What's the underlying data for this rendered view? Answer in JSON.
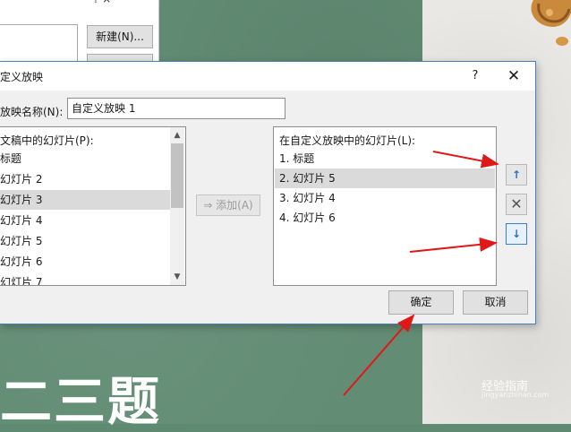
{
  "background_dialog": {
    "new_button": "新建(N)...",
    "title_icons": "?   ×"
  },
  "dialog": {
    "title": "定义放映",
    "help": "?",
    "close": "✕",
    "name_label": "放映名称(N):",
    "name_value": "自定义放映 1",
    "left_list": {
      "header": "文稿中的幻灯片(P):",
      "items": [
        "标题",
        "幻灯片 2",
        "幻灯片 3",
        "幻灯片 4",
        "幻灯片 5",
        "幻灯片 6",
        "幻灯片 7"
      ],
      "selected_index": 2
    },
    "add_button": "添加(A)",
    "right_list": {
      "header": "在自定义放映中的幻灯片(L):",
      "items": [
        "1. 标题",
        "2. 幻灯片 5",
        "3. 幻灯片 4",
        "4. 幻灯片 6"
      ],
      "selected_index": 1
    },
    "move_up_icon": "↑",
    "delete_icon": "✕",
    "move_down_icon": "↓",
    "ok_button": "确定",
    "cancel_button": "取消"
  },
  "slide_text": "二三题",
  "watermark": {
    "text": "经验指南",
    "sub": "jingyanzhinan.com"
  },
  "colors": {
    "slide_green": "#628c74",
    "arrow_red": "#e01818",
    "accent_blue": "#2f6fbd"
  }
}
